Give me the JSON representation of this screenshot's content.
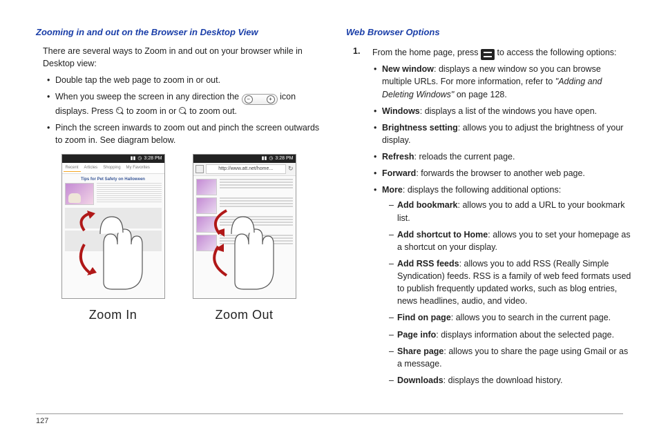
{
  "page_number": "127",
  "left": {
    "heading": "Zooming in and out on the Browser in Desktop View",
    "intro": "There are several ways to Zoom in and out on your browser while in Desktop view:",
    "b1": "Double tap the web page to zoom in or out.",
    "b2a": "When you sweep the screen in any direction the ",
    "b2b": " icon displays. Press ",
    "b2c": " to zoom in or ",
    "b2d": " to zoom out.",
    "b3": "Pinch the screen inwards to zoom out and pinch the screen outwards to zoom in. See diagram below.",
    "time_label": "3:28 PM",
    "url_label": "http://www.att.net/home...",
    "tabs": {
      "a": "Recent",
      "b": "Articles",
      "c": "Shopping",
      "d": "My Favorites"
    },
    "article_title": "Tips for Pet Safety on Halloween",
    "caption_in": "Zoom In",
    "caption_out": "Zoom Out"
  },
  "right": {
    "heading": "Web Browser Options",
    "step1_num": "1.",
    "step1a": "From the home page, press ",
    "step1b": " to access the following options:",
    "items": {
      "new_window_t": "New window",
      "new_window_d": ": displays a new window so you can browse multiple URLs. For more information, refer to ",
      "new_window_ref": "\"Adding and Deleting Windows\"",
      "new_window_d2": "  on page 128.",
      "windows_t": "Windows",
      "windows_d": ": displays a list of the windows you have open.",
      "bright_t": "Brightness setting",
      "bright_d": ": allows you to adjust the brightness of your display.",
      "refresh_t": "Refresh",
      "refresh_d": ": reloads the current page.",
      "forward_t": "Forward",
      "forward_d": ": forwards the browser to another web page.",
      "more_t": "More",
      "more_d": ": displays the following additional options:",
      "sub": {
        "bm_t": "Add bookmark",
        "bm_d": ": allows you to add a URL to your bookmark list.",
        "sc_t": "Add shortcut to Home",
        "sc_d": ": allows you to set your homepage as a shortcut on your display.",
        "rss_t": "Add RSS feeds",
        "rss_d": ": allows you to add RSS (Really Simple Syndication) feeds. RSS is a family of web feed formats used to publish frequently updated works, such as blog entries, news headlines, audio, and video.",
        "fp_t": "Find on page",
        "fp_d": ": allows you to search in the current page.",
        "pi_t": "Page info",
        "pi_d": ": displays information about the selected page.",
        "sp_t": "Share page",
        "sp_d": ": allows you to share the page using Gmail or as a message.",
        "dl_t": "Downloads",
        "dl_d": ": displays the download history."
      }
    }
  }
}
